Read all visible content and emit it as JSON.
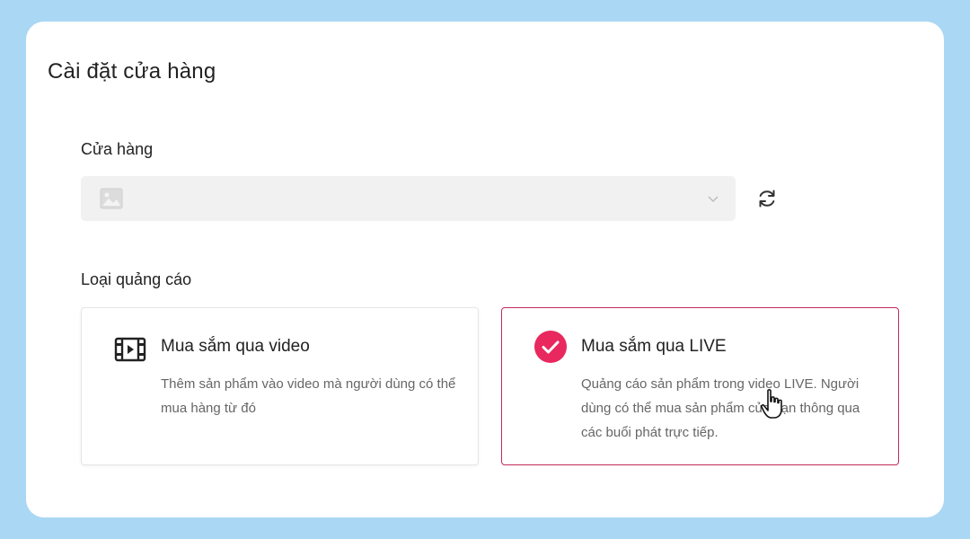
{
  "page": {
    "title": "Cài đặt cửa hàng"
  },
  "store": {
    "label": "Cửa hàng",
    "selected_value": "",
    "icons": {
      "placeholder": "image-icon",
      "dropdown": "chevron-down-icon",
      "refresh": "refresh-icon"
    }
  },
  "ad_type": {
    "label": "Loại quảng cáo",
    "options": [
      {
        "title": "Mua sắm qua video",
        "description": "Thêm sản phẩm vào video mà người dùng có thể mua hàng từ đó",
        "icon": "film-icon",
        "selected": false
      },
      {
        "title": "Mua sắm qua LIVE",
        "description": "Quảng cáo sản phẩm trong video LIVE. Người dùng có thể mua sản phẩm của bạn thông qua các buổi phát trực tiếp.",
        "icon": "check-circle-icon",
        "selected": true
      }
    ]
  },
  "colors": {
    "accent": "#e8285e",
    "selected_border": "#c22a58",
    "background": "#a9d7f4"
  }
}
